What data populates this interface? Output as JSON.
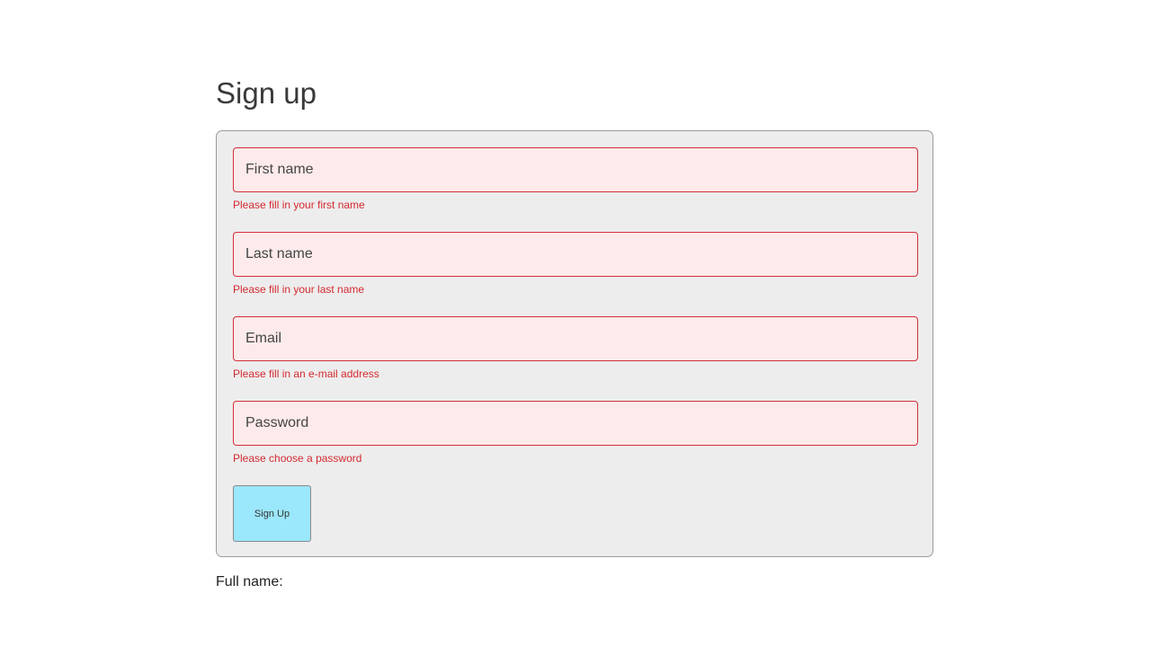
{
  "page": {
    "title": "Sign up"
  },
  "form": {
    "fields": [
      {
        "placeholder": "First name",
        "value": "",
        "error": "Please fill in your first name"
      },
      {
        "placeholder": "Last name",
        "value": "",
        "error": "Please fill in your last name"
      },
      {
        "placeholder": "Email",
        "value": "",
        "error": "Please fill in an e-mail address"
      },
      {
        "placeholder": "Password",
        "value": "",
        "error": "Please choose a password"
      }
    ],
    "submit_label": "Sign Up"
  },
  "footer": {
    "full_name_label": "Full name:"
  },
  "colors": {
    "error": "#d42a30",
    "input_background": "#fdeaea",
    "panel_background": "#ededed",
    "button_background": "#9be7fb"
  }
}
